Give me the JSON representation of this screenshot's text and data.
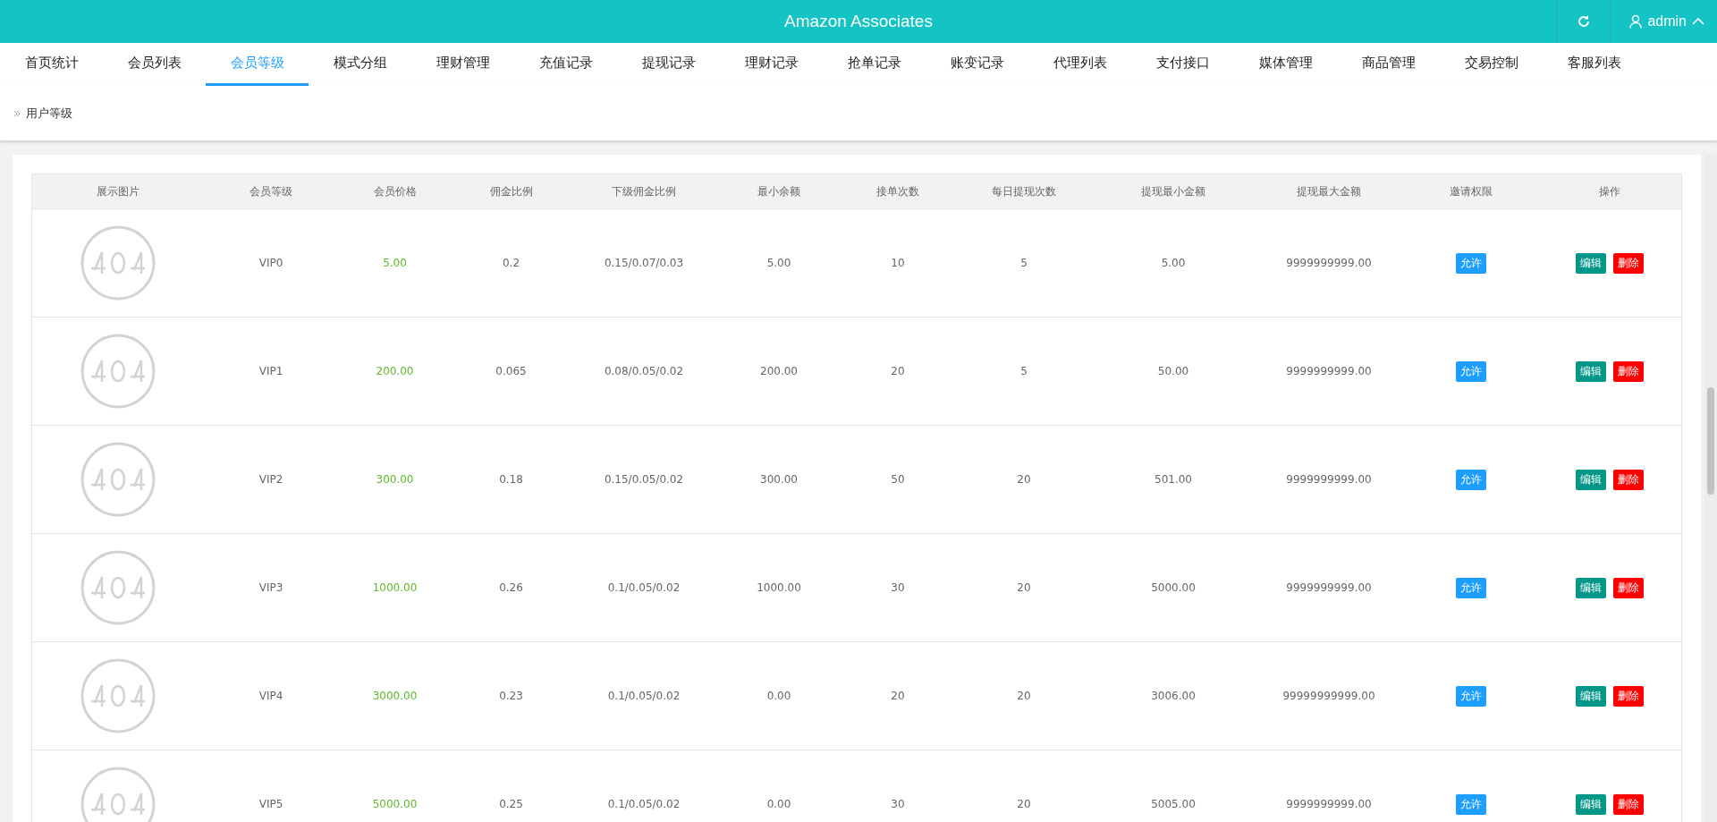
{
  "header": {
    "title": "Amazon Associates",
    "user": "admin"
  },
  "nav": [
    {
      "label": "首页统计",
      "selected": false
    },
    {
      "label": "会员列表",
      "selected": false
    },
    {
      "label": "会员等级",
      "selected": true
    },
    {
      "label": "模式分组",
      "selected": false
    },
    {
      "label": "理财管理",
      "selected": false
    },
    {
      "label": "充值记录",
      "selected": false
    },
    {
      "label": "提现记录",
      "selected": false
    },
    {
      "label": "理财记录",
      "selected": false
    },
    {
      "label": "抢单记录",
      "selected": false
    },
    {
      "label": "账变记录",
      "selected": false
    },
    {
      "label": "代理列表",
      "selected": false
    },
    {
      "label": "支付接口",
      "selected": false
    },
    {
      "label": "媒体管理",
      "selected": false
    },
    {
      "label": "商品管理",
      "selected": false
    },
    {
      "label": "交易控制",
      "selected": false
    },
    {
      "label": "客服列表",
      "selected": false
    }
  ],
  "breadcrumb": "用户等级",
  "table": {
    "columns": [
      "展示图片",
      "会员等级",
      "会员价格",
      "佣金比例",
      "下级佣金比例",
      "最小余额",
      "接单次数",
      "每日提现次数",
      "提现最小金额",
      "提现最大金额",
      "邀请权限",
      "操作"
    ],
    "rows": [
      {
        "level": "VIP0",
        "price": "5.00",
        "commission": "0.2",
        "sub_commission": "0.15/0.07/0.03",
        "min_balance": "5.00",
        "orders": "10",
        "daily_withdrawals": "5",
        "withdraw_min": "5.00",
        "withdraw_max": "9999999999.00",
        "invite": "允许",
        "actions": [
          "编辑",
          "删除"
        ]
      },
      {
        "level": "VIP1",
        "price": "200.00",
        "commission": "0.065",
        "sub_commission": "0.08/0.05/0.02",
        "min_balance": "200.00",
        "orders": "20",
        "daily_withdrawals": "5",
        "withdraw_min": "50.00",
        "withdraw_max": "9999999999.00",
        "invite": "允许",
        "actions": [
          "编辑",
          "删除"
        ]
      },
      {
        "level": "VIP2",
        "price": "300.00",
        "commission": "0.18",
        "sub_commission": "0.15/0.05/0.02",
        "min_balance": "300.00",
        "orders": "50",
        "daily_withdrawals": "20",
        "withdraw_min": "501.00",
        "withdraw_max": "9999999999.00",
        "invite": "允许",
        "actions": [
          "编辑",
          "删除"
        ]
      },
      {
        "level": "VIP3",
        "price": "1000.00",
        "commission": "0.26",
        "sub_commission": "0.1/0.05/0.02",
        "min_balance": "1000.00",
        "orders": "30",
        "daily_withdrawals": "20",
        "withdraw_min": "5000.00",
        "withdraw_max": "9999999999.00",
        "invite": "允许",
        "actions": [
          "编辑",
          "删除"
        ]
      },
      {
        "level": "VIP4",
        "price": "3000.00",
        "commission": "0.23",
        "sub_commission": "0.1/0.05/0.02",
        "min_balance": "0.00",
        "orders": "20",
        "daily_withdrawals": "20",
        "withdraw_min": "3006.00",
        "withdraw_max": "99999999999.00",
        "invite": "允许",
        "actions": [
          "编辑",
          "删除"
        ]
      },
      {
        "level": "VIP5",
        "price": "5000.00",
        "commission": "0.25",
        "sub_commission": "0.1/0.05/0.02",
        "min_balance": "0.00",
        "orders": "30",
        "daily_withdrawals": "20",
        "withdraw_min": "5005.00",
        "withdraw_max": "9999999999.00",
        "invite": "允许",
        "actions": [
          "编辑",
          "删除"
        ]
      }
    ]
  }
}
